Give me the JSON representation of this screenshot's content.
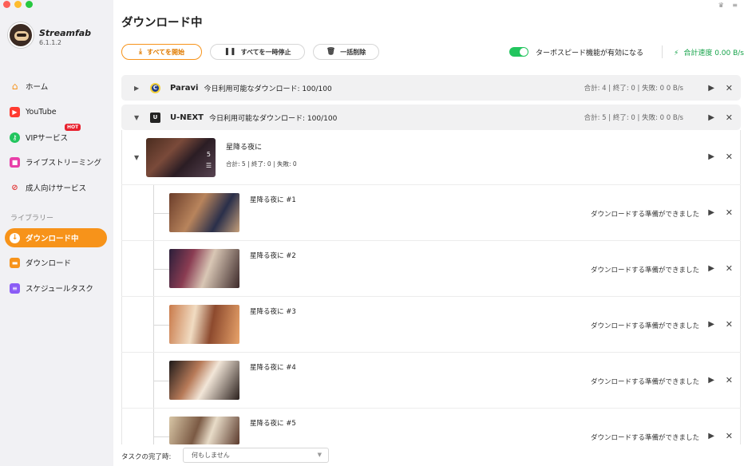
{
  "app": {
    "brand": "Streamfab",
    "version": "6.1.1.2"
  },
  "sidebar": {
    "items": [
      {
        "label": "ホーム",
        "icon": "home-icon",
        "color": "#f7931a"
      },
      {
        "label": "YouTube",
        "icon": "youtube-icon",
        "color": "#ff3b30"
      },
      {
        "label": "VIPサービス",
        "icon": "key-icon",
        "color": "#22c55e",
        "badge": "HOT"
      },
      {
        "label": "ライブストリーミング",
        "icon": "video-camera-icon",
        "color": "#e83ea8"
      },
      {
        "label": "成人向けサービス",
        "icon": "adult-icon",
        "color": "#e23b3b"
      }
    ],
    "library_label": "ライブラリー",
    "library": [
      {
        "label": "ダウンロード中",
        "icon": "download-arrow-icon",
        "active": true
      },
      {
        "label": "ダウンロード",
        "icon": "folder-icon",
        "color": "#f7931a"
      },
      {
        "label": "スケジュールタスク",
        "icon": "schedule-list-icon",
        "color": "#8b5cf6"
      }
    ]
  },
  "header": {
    "title": "ダウンロード中",
    "buttons": {
      "start_all": "すべてを開始",
      "pause_all": "すべてを一時停止",
      "delete_all": "一括削除"
    },
    "turbo_label": "ターボスピード機能が有効になる",
    "turbo_enabled": true,
    "speed": "合計速度 0.00 B/s"
  },
  "groups": [
    {
      "service": "Paravi",
      "info": "今日利用可能なダウンロード: 100/100",
      "stats": "合計: 4  |  終了: 0  |  失敗: 0     0 B/s",
      "expanded": false,
      "color": "#1e3a8a"
    },
    {
      "service": "U-NEXT",
      "info": "今日利用可能なダウンロード: 100/100",
      "stats": "合計: 5  |  終了: 0  |  失敗: 0     0 B/s",
      "expanded": true,
      "color": "#222222"
    }
  ],
  "series": {
    "title": "星降る夜に",
    "count": "5",
    "summary": "合計: 5  |  終了: 0  |  失敗: 0"
  },
  "episodes": [
    {
      "title": "星降る夜に #1",
      "status": "ダウンロードする準備ができました"
    },
    {
      "title": "星降る夜に #2",
      "status": "ダウンロードする準備ができました"
    },
    {
      "title": "星降る夜に #3",
      "status": "ダウンロードする準備ができました"
    },
    {
      "title": "星降る夜に #4",
      "status": "ダウンロードする準備ができました"
    },
    {
      "title": "星降る夜に #5",
      "status": "ダウンロードする準備ができました"
    }
  ],
  "footer": {
    "label": "タスクの完了時:",
    "selected": "何もしません"
  },
  "colors": {
    "accent": "#f7931a",
    "turbo": "#22c55e"
  }
}
